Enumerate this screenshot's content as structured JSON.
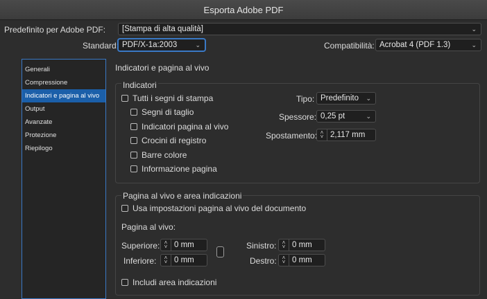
{
  "window": {
    "title": "Esporta Adobe PDF"
  },
  "top": {
    "preset_label": "Predefinito per Adobe PDF:",
    "preset_value": "[Stampa di alta qualità]",
    "standard_label": "Standard:",
    "standard_value": "PDF/X-1a:2003",
    "compat_label": "Compatibilità:",
    "compat_value": "Acrobat 4 (PDF 1.3)"
  },
  "sidebar": {
    "items": [
      {
        "label": "Generali"
      },
      {
        "label": "Compressione"
      },
      {
        "label": "Indicatori e pagina al vivo"
      },
      {
        "label": "Output"
      },
      {
        "label": "Avanzate"
      },
      {
        "label": "Protezione"
      },
      {
        "label": "Riepilogo"
      }
    ],
    "selected_index": 2
  },
  "main": {
    "section_title": "Indicatori e pagina al vivo",
    "marks": {
      "group_title": "Indicatori",
      "all_marks": "Tutti i segni di stampa",
      "items": [
        {
          "label": "Segni di taglio"
        },
        {
          "label": "Indicatori pagina al vivo"
        },
        {
          "label": "Crocini di registro"
        },
        {
          "label": "Barre colore"
        },
        {
          "label": "Informazione pagina"
        }
      ],
      "type_label": "Tipo:",
      "type_value": "Predefinito",
      "weight_label": "Spessore:",
      "weight_value": "0,25 pt",
      "offset_label": "Spostamento:",
      "offset_value": "2,117 mm"
    },
    "bleed": {
      "group_title": "Pagina al vivo e area indicazioni",
      "use_doc": "Usa impostazioni pagina al vivo del documento",
      "bleed_label": "Pagina al vivo:",
      "top_label": "Superiore:",
      "top_value": "0 mm",
      "bottom_label": "Inferiore:",
      "bottom_value": "0 mm",
      "left_label": "Sinistro:",
      "left_value": "0 mm",
      "right_label": "Destro:",
      "right_value": "0 mm",
      "slug": "Includi area indicazioni"
    }
  },
  "colors": {
    "accent": "#1b5fa9",
    "focus": "#3a79c6",
    "bg": "#2d2d2d"
  },
  "icons": [
    "chevron-down-icon",
    "stepper-icon",
    "chain-link-icon",
    "checkbox-icon"
  ]
}
